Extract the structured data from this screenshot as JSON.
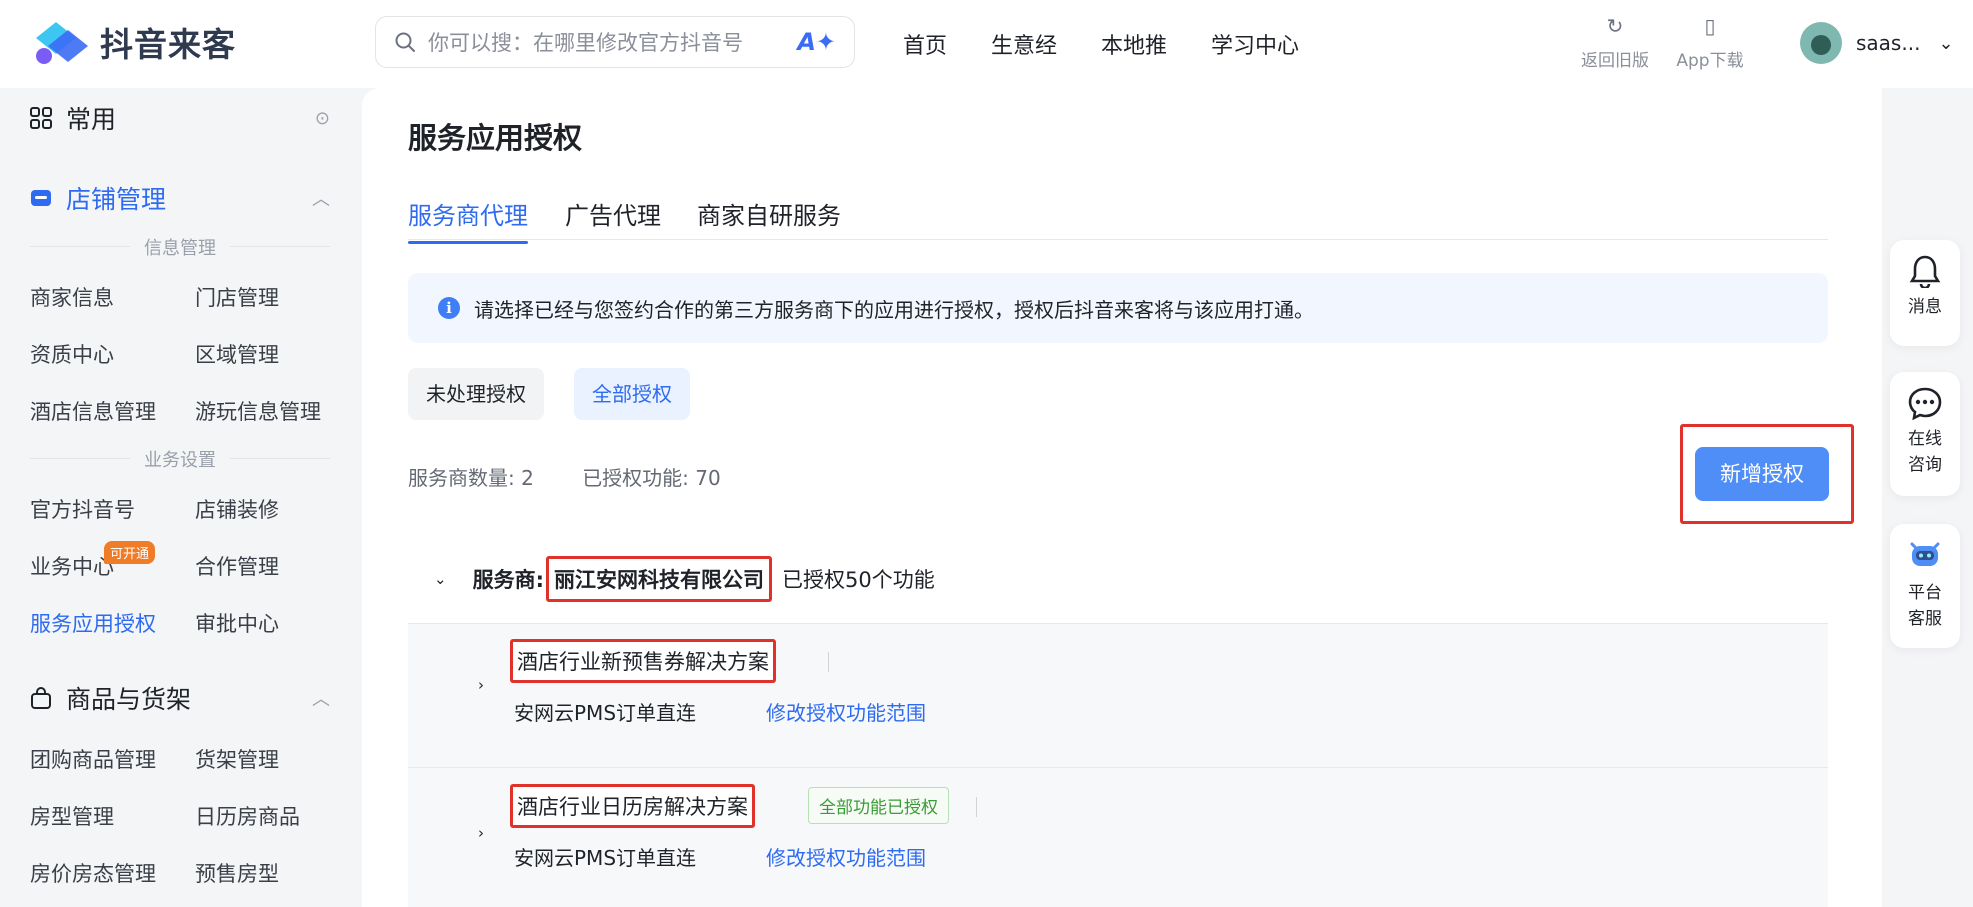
{
  "app": {
    "brand": "抖音来客",
    "search_placeholder": "你可以搜：在哪里修改官方抖音号",
    "nav": [
      "首页",
      "生意经",
      "本地推",
      "学习中心"
    ],
    "tools": {
      "back_old": "返回旧版",
      "app_download": "App下载"
    },
    "user_name": "saas..."
  },
  "sidebar": {
    "common_title": "常用",
    "store_section": {
      "title": "店铺管理",
      "group1_label": "信息管理",
      "group1_items": [
        "商家信息",
        "门店管理",
        "资质中心",
        "区域管理",
        "酒店信息管理",
        "游玩信息管理"
      ],
      "group2_label": "业务设置",
      "group2_items": [
        "官方抖音号",
        "店铺装修",
        "业务中心",
        "合作管理",
        "服务应用授权",
        "审批中心"
      ],
      "badge": "可开通"
    },
    "goods_section": {
      "title": "商品与货架",
      "items": [
        "团购商品管理",
        "货架管理",
        "房型管理",
        "日历房商品",
        "房价房态管理",
        "预售房型"
      ]
    }
  },
  "main": {
    "title": "服务应用授权",
    "tabs": [
      "服务商代理",
      "广告代理",
      "商家自研服务"
    ],
    "notice": "请选择已经与您签约合作的第三方服务商下的应用进行授权，授权后抖音来客将与该应用打通。",
    "filters": [
      "未处理授权",
      "全部授权"
    ],
    "stats": {
      "provider_count": "服务商数量: 2",
      "authorized_features": "已授权功能: 70"
    },
    "add_button": "新增授权",
    "provider": {
      "label": "服务商:",
      "name": "丽江安网科技有限公司",
      "count": "已授权50个功能"
    },
    "solutions": [
      {
        "name": "酒店行业新预售券解决方案",
        "tag": "",
        "function": "安网云PMS订单直连",
        "link": "修改授权功能范围"
      },
      {
        "name": "酒店行业日历房解决方案",
        "tag": "全部功能已授权",
        "function": "安网云PMS订单直连",
        "link": "修改授权功能范围"
      }
    ]
  },
  "float": {
    "messages": "消息",
    "consult": "在线咨询",
    "service": "平台客服"
  },
  "colors": {
    "accent": "#2f6bf0",
    "highlight_red": "#e0322b",
    "badge_orange": "#f07c28",
    "tag_green": "#3b9b36"
  }
}
